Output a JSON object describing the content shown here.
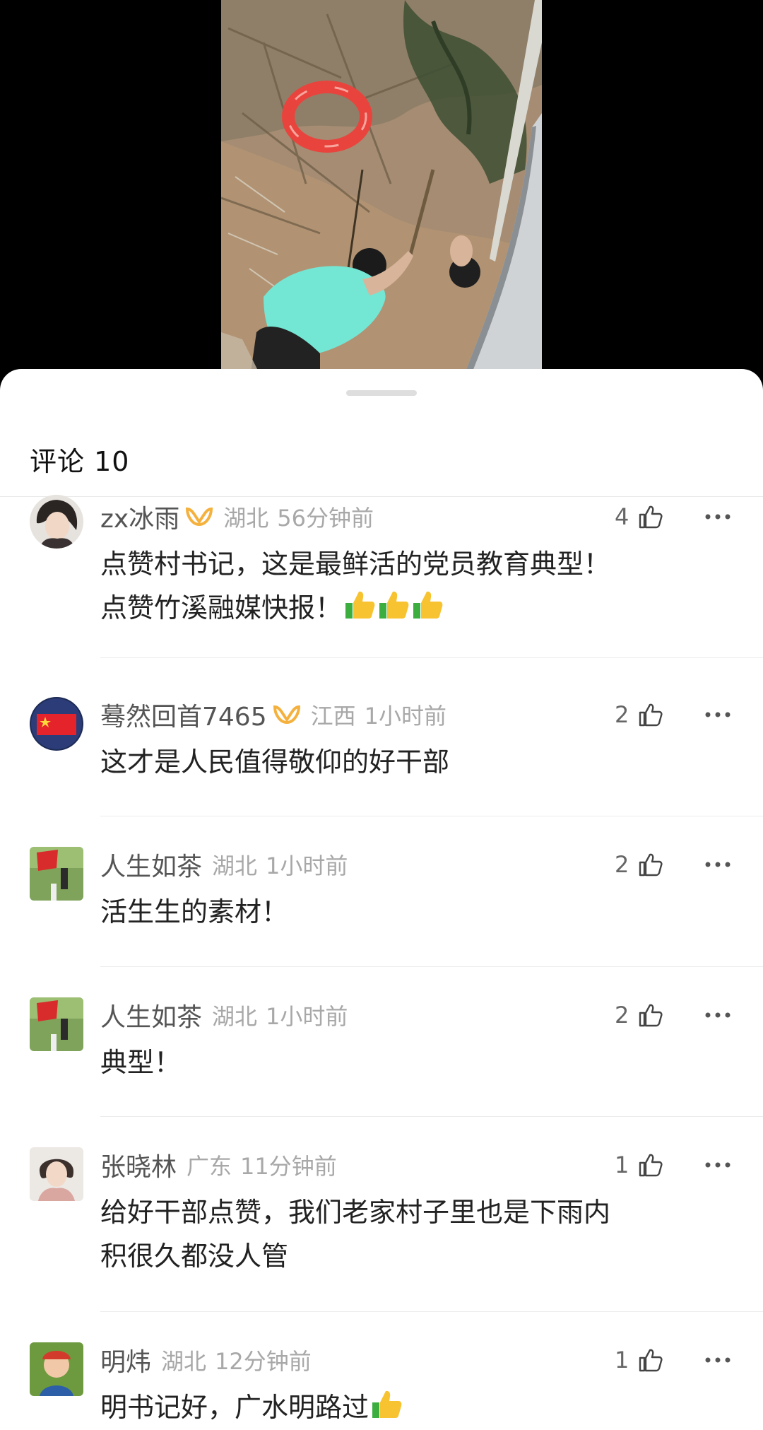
{
  "video": {
    "description_icon": "video-frame"
  },
  "comments_header": {
    "title": "评论 10"
  },
  "comments": [
    {
      "username": "zx冰雨",
      "vip": true,
      "region": "湖北",
      "time": "56分钟前",
      "likes": "4",
      "lines": [
        "点赞村书记，这是最鲜活的党员教育典型！",
        "点赞竹溪融媒快报！"
      ],
      "emoji_after_last_line": 3
    },
    {
      "username": "蓦然回首7465",
      "vip": true,
      "region": "江西",
      "time": "1小时前",
      "likes": "2",
      "lines": [
        "这才是人民值得敬仰的好干部"
      ],
      "emoji_after_last_line": 0
    },
    {
      "username": "人生如茶",
      "vip": false,
      "region": "湖北",
      "time": "1小时前",
      "likes": "2",
      "lines": [
        "活生生的素材！"
      ],
      "emoji_after_last_line": 0
    },
    {
      "username": "人生如茶",
      "vip": false,
      "region": "湖北",
      "time": "1小时前",
      "likes": "2",
      "lines": [
        "典型！"
      ],
      "emoji_after_last_line": 0
    },
    {
      "username": "张晓林",
      "vip": false,
      "region": "广东",
      "time": "11分钟前",
      "likes": "1",
      "lines": [
        "给好干部点赞，我们老家村子里也是下雨内",
        "积很久都没人管"
      ],
      "emoji_after_last_line": 0
    },
    {
      "username": "明炜",
      "vip": false,
      "region": "湖北",
      "time": "12分钟前",
      "likes": "1",
      "lines": [
        "明书记好，广水明路过"
      ],
      "emoji_after_last_line": 1
    }
  ],
  "colors": {
    "accent_vip": "#f5b13d",
    "emoji_yellow": "#f7c331",
    "emoji_green": "#3cae3f"
  },
  "icons": [
    "vip-badge-icon",
    "thumbs-up-icon",
    "more-options-icon",
    "thumbs-up-emoji-icon"
  ]
}
